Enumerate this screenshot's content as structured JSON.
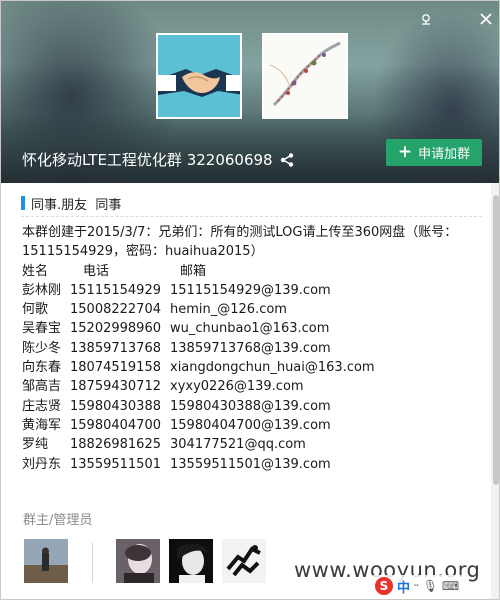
{
  "window": {
    "pin_icon": "pin-icon",
    "close_icon": "close-icon"
  },
  "group": {
    "title": "怀化移动LTE工程优化群 322060698",
    "share_icon": "share-icon",
    "join_label": "申请加群"
  },
  "tags": {
    "items": "同事.朋友  同事"
  },
  "notice": {
    "line1": "本群创建于2015/3/7：兄弟们：所有的测试LOG请上传至360网盘（账号：",
    "line2": "15115154929，密码：huaihua2015）"
  },
  "contacts": {
    "header": {
      "name": "姓名",
      "phone": "电话",
      "mail": "邮箱"
    },
    "rows": [
      {
        "name": "彭林刚",
        "phone": "15115154929",
        "mail": "15115154929@139.com"
      },
      {
        "name": "何歌",
        "phone": "15008222704",
        "mail": "hemin_@126.com"
      },
      {
        "name": "吴春宝",
        "phone": "15202998960",
        "mail": "wu_chunbao1@163.com"
      },
      {
        "name": "陈少冬",
        "phone": "13859713768",
        "mail": "13859713768@139.com"
      },
      {
        "name": "向东春",
        "phone": "18074519158",
        "mail": "xiangdongchun_huai@163.com"
      },
      {
        "name": "邹高吉",
        "phone": "18759430712",
        "mail": "xyxy0226@139.com"
      },
      {
        "name": "庄志贤",
        "phone": "15980430388",
        "mail": "15980430388@139.com"
      },
      {
        "name": "黄海军",
        "phone": "15980404700",
        "mail": "15980404700@139.com"
      },
      {
        "name": "罗纯",
        "phone": "18826981625",
        "mail": "304177521@qq.com"
      },
      {
        "name": "刘丹东",
        "phone": "13559511501",
        "mail": "13559511501@139.com"
      }
    ]
  },
  "admins": {
    "label": "群主/管理员"
  },
  "watermark": {
    "text": "www.wooyun.org"
  },
  "ime": {
    "logo": "S",
    "lang": "中",
    "extra": "ᵕ 🎙 ⌨"
  },
  "colors": {
    "join_button": "#24a46a",
    "tag_bar": "#1e8fe1"
  }
}
